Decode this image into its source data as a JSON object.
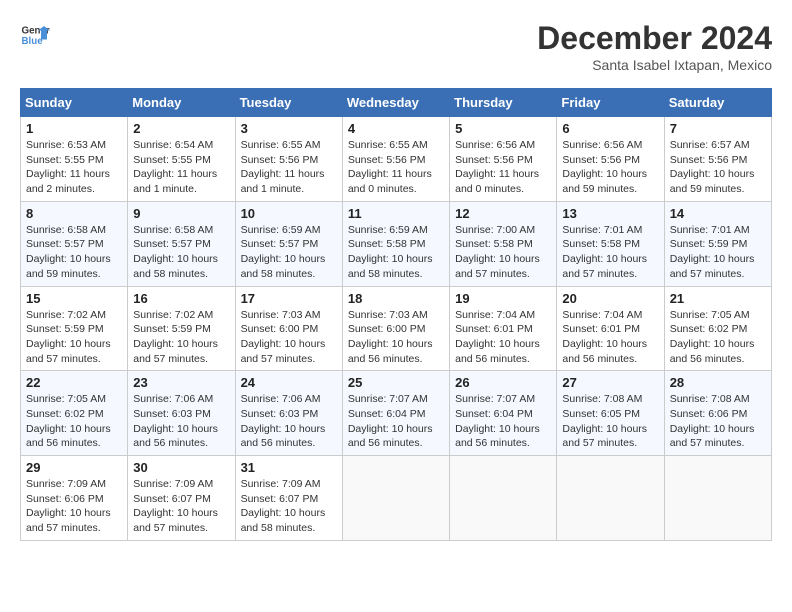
{
  "logo": {
    "line1": "General",
    "line2": "Blue"
  },
  "title": "December 2024",
  "subtitle": "Santa Isabel Ixtapan, Mexico",
  "headers": [
    "Sunday",
    "Monday",
    "Tuesday",
    "Wednesday",
    "Thursday",
    "Friday",
    "Saturday"
  ],
  "weeks": [
    [
      {
        "day": "1",
        "rise": "6:53 AM",
        "set": "5:55 PM",
        "daylight": "11 hours and 2 minutes."
      },
      {
        "day": "2",
        "rise": "6:54 AM",
        "set": "5:55 PM",
        "daylight": "11 hours and 1 minute."
      },
      {
        "day": "3",
        "rise": "6:55 AM",
        "set": "5:56 PM",
        "daylight": "11 hours and 1 minute."
      },
      {
        "day": "4",
        "rise": "6:55 AM",
        "set": "5:56 PM",
        "daylight": "11 hours and 0 minutes."
      },
      {
        "day": "5",
        "rise": "6:56 AM",
        "set": "5:56 PM",
        "daylight": "11 hours and 0 minutes."
      },
      {
        "day": "6",
        "rise": "6:56 AM",
        "set": "5:56 PM",
        "daylight": "10 hours and 59 minutes."
      },
      {
        "day": "7",
        "rise": "6:57 AM",
        "set": "5:56 PM",
        "daylight": "10 hours and 59 minutes."
      }
    ],
    [
      {
        "day": "8",
        "rise": "6:58 AM",
        "set": "5:57 PM",
        "daylight": "10 hours and 59 minutes."
      },
      {
        "day": "9",
        "rise": "6:58 AM",
        "set": "5:57 PM",
        "daylight": "10 hours and 58 minutes."
      },
      {
        "day": "10",
        "rise": "6:59 AM",
        "set": "5:57 PM",
        "daylight": "10 hours and 58 minutes."
      },
      {
        "day": "11",
        "rise": "6:59 AM",
        "set": "5:58 PM",
        "daylight": "10 hours and 58 minutes."
      },
      {
        "day": "12",
        "rise": "7:00 AM",
        "set": "5:58 PM",
        "daylight": "10 hours and 57 minutes."
      },
      {
        "day": "13",
        "rise": "7:01 AM",
        "set": "5:58 PM",
        "daylight": "10 hours and 57 minutes."
      },
      {
        "day": "14",
        "rise": "7:01 AM",
        "set": "5:59 PM",
        "daylight": "10 hours and 57 minutes."
      }
    ],
    [
      {
        "day": "15",
        "rise": "7:02 AM",
        "set": "5:59 PM",
        "daylight": "10 hours and 57 minutes."
      },
      {
        "day": "16",
        "rise": "7:02 AM",
        "set": "5:59 PM",
        "daylight": "10 hours and 57 minutes."
      },
      {
        "day": "17",
        "rise": "7:03 AM",
        "set": "6:00 PM",
        "daylight": "10 hours and 57 minutes."
      },
      {
        "day": "18",
        "rise": "7:03 AM",
        "set": "6:00 PM",
        "daylight": "10 hours and 56 minutes."
      },
      {
        "day": "19",
        "rise": "7:04 AM",
        "set": "6:01 PM",
        "daylight": "10 hours and 56 minutes."
      },
      {
        "day": "20",
        "rise": "7:04 AM",
        "set": "6:01 PM",
        "daylight": "10 hours and 56 minutes."
      },
      {
        "day": "21",
        "rise": "7:05 AM",
        "set": "6:02 PM",
        "daylight": "10 hours and 56 minutes."
      }
    ],
    [
      {
        "day": "22",
        "rise": "7:05 AM",
        "set": "6:02 PM",
        "daylight": "10 hours and 56 minutes."
      },
      {
        "day": "23",
        "rise": "7:06 AM",
        "set": "6:03 PM",
        "daylight": "10 hours and 56 minutes."
      },
      {
        "day": "24",
        "rise": "7:06 AM",
        "set": "6:03 PM",
        "daylight": "10 hours and 56 minutes."
      },
      {
        "day": "25",
        "rise": "7:07 AM",
        "set": "6:04 PM",
        "daylight": "10 hours and 56 minutes."
      },
      {
        "day": "26",
        "rise": "7:07 AM",
        "set": "6:04 PM",
        "daylight": "10 hours and 56 minutes."
      },
      {
        "day": "27",
        "rise": "7:08 AM",
        "set": "6:05 PM",
        "daylight": "10 hours and 57 minutes."
      },
      {
        "day": "28",
        "rise": "7:08 AM",
        "set": "6:06 PM",
        "daylight": "10 hours and 57 minutes."
      }
    ],
    [
      {
        "day": "29",
        "rise": "7:09 AM",
        "set": "6:06 PM",
        "daylight": "10 hours and 57 minutes."
      },
      {
        "day": "30",
        "rise": "7:09 AM",
        "set": "6:07 PM",
        "daylight": "10 hours and 57 minutes."
      },
      {
        "day": "31",
        "rise": "7:09 AM",
        "set": "6:07 PM",
        "daylight": "10 hours and 58 minutes."
      },
      null,
      null,
      null,
      null
    ]
  ],
  "labels": {
    "sunrise": "Sunrise:",
    "sunset": "Sunset:",
    "daylight": "Daylight:"
  }
}
